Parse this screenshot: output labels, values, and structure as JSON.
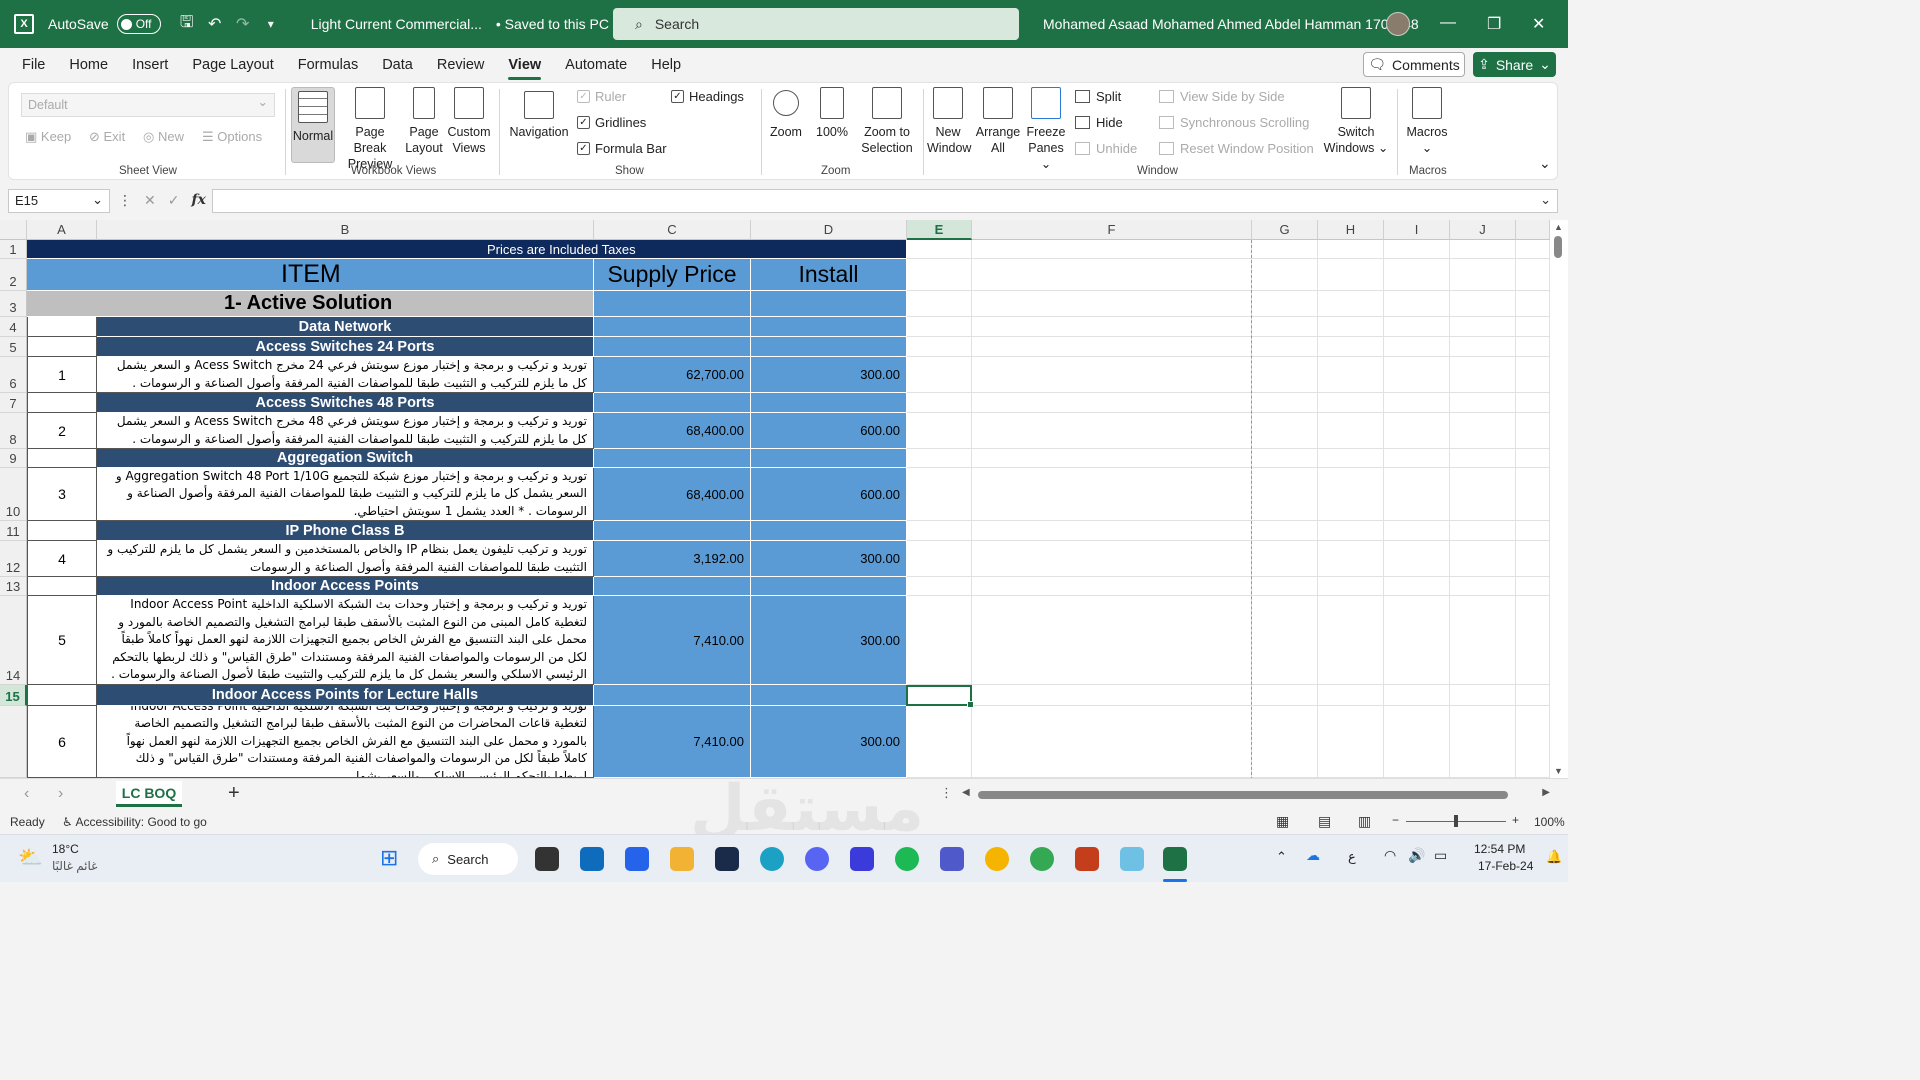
{
  "titlebar": {
    "autosave_label": "AutoSave",
    "autosave_state": "Off",
    "doc_title": "Light Current Commercial...",
    "saved_status": "• Saved to this PC ⌄",
    "search_placeholder": "Search",
    "user_name": "Mohamed Asaad Mohamed Ahmed Abdel Hamman 1701148"
  },
  "menu": {
    "items": [
      "File",
      "Home",
      "Insert",
      "Page Layout",
      "Formulas",
      "Data",
      "Review",
      "View",
      "Automate",
      "Help"
    ],
    "active": "View",
    "comments": "Comments",
    "share": "Share"
  },
  "ribbon": {
    "sheet_view": {
      "dropdown": "Default",
      "keep": "Keep",
      "exit": "Exit",
      "new": "New",
      "options": "Options",
      "label": "Sheet View"
    },
    "workbook_views": {
      "normal": "Normal",
      "page_break": "Page Break",
      "page_break2": "Preview",
      "page_layout": "Page",
      "page_layout2": "Layout",
      "custom": "Custom",
      "custom2": "Views",
      "label": "Workbook Views"
    },
    "show": {
      "navigation": "Navigation",
      "ruler": "Ruler",
      "gridlines": "Gridlines",
      "formula_bar": "Formula Bar",
      "headings": "Headings",
      "label": "Show"
    },
    "zoom": {
      "zoom": "Zoom",
      "hundred": "100%",
      "zoom_sel": "Zoom to",
      "zoom_sel2": "Selection",
      "label": "Zoom"
    },
    "window": {
      "new_window": "New",
      "new_window2": "Window",
      "arrange": "Arrange",
      "arrange2": "All",
      "freeze": "Freeze",
      "freeze2": "Panes ⌄",
      "split": "Split",
      "hide": "Hide",
      "unhide": "Unhide",
      "side": "View Side by Side",
      "sync": "Synchronous Scrolling",
      "reset": "Reset Window Position",
      "switch": "Switch",
      "switch2": "Windows ⌄",
      "label": "Window"
    },
    "macros": {
      "macros": "Macros",
      "label": "Macros"
    }
  },
  "formula_bar": {
    "name_box": "E15",
    "fx": "fx",
    "content": ""
  },
  "columns": [
    "A",
    "B",
    "C",
    "D",
    "E",
    "F",
    "G",
    "H",
    "I",
    "J"
  ],
  "rows": [
    "1",
    "2",
    "3",
    "4",
    "5",
    "6",
    "7",
    "8",
    "9",
    "10",
    "11",
    "12",
    "13",
    "14",
    "15"
  ],
  "sheet": {
    "r1_title": "Prices are Included Taxes",
    "header_item": "ITEM",
    "header_supply": "Supply Price",
    "header_install": "Install",
    "section": "1- Active Solution",
    "subsection": "Data Network",
    "groups": [
      {
        "title": "Access Switches 24 Ports",
        "no": "1",
        "desc": "توريد و تركيب و برمجة و إختبار موزع سويتش فرعي 24 مخرج Acess Switch و السعر يشمل كل ما يلزم للتركيب و التثبيت طبقا للمواصفات الفنية المرفقة وأصول الصناعة و الرسومات .",
        "supply": "62,700.00",
        "install": "300.00"
      },
      {
        "title": "Access Switches 48 Ports",
        "no": "2",
        "desc": "توريد و تركيب و برمجة و إختبار موزع سويتش فرعي 48 مخرج Acess Switch و السعر يشمل كل ما يلزم للتركيب و التثبيت طبقا للمواصفات الفنية المرفقة وأصول الصناعة و الرسومات .",
        "supply": "68,400.00",
        "install": "600.00"
      },
      {
        "title": "Aggregation Switch",
        "no": "3",
        "desc": "توريد و تركيب و برمجة و إختبار موزع شبكة للتجميع Aggregation Switch 48 Port 1/10G و السعر يشمل كل ما يلزم للتركيب و التثبيت طبقا للمواصفات الفنية المرفقة وأصول الصناعة و الرسومات . * العدد يشمل 1 سويتش احتياطي.",
        "supply": "68,400.00",
        "install": "600.00"
      },
      {
        "title": "IP Phone Class B",
        "no": "4",
        "desc": "توريد و تركيب تليفون يعمل بنظام IP والخاص بالمستخدمين و السعر يشمل كل ما يلزم للتركيب و التثبيت طبقا للمواصفات الفنية المرفقة وأصول الصناعة و الرسومات",
        "supply": "3,192.00",
        "install": "300.00"
      },
      {
        "title": "Indoor Access Points",
        "no": "5",
        "desc": "توريد و تركيب و برمجة و إختبار وحدات بث الشبكة الاسلكية الداخلية Indoor Access Point لتغطية كامل المبنى من النوع المثبت بالأسقف طبقا لبرامج التشغيل والتصميم الخاصة بالمورد و محمل على البند التنسيق مع الفرش الخاص بجميع التجهيزات اللازمة لنهو العمل نهواً كاملاً طبقاً لكل من الرسومات والمواصفات الفنية المرفقة ومستندات \"طرق القياس\" و ذلك لربطها بالتحكم الرئيسي الاسلكي والسعر يشمل كل ما يلزم للتركيب والتثبيت طبقا لأصول الصناعة والرسومات .",
        "supply": "7,410.00",
        "install": "300.00"
      },
      {
        "title": "Indoor Access Points for Lecture Halls",
        "no": "6",
        "desc": "توريد و تركيب و برمجة و إختبار وحدات بث الشبكة الاسلكية الداخلية Indoor Access Point لتغطية قاعات المحاضرات من النوع المثبت بالأسقف طبقا لبرامج التشغيل والتصميم الخاصة بالمورد و محمل على البند التنسيق مع الفرش الخاص بجميع التجهيزات اللازمة لنهو العمل نهواً كاملاً طبقاً لكل من الرسومات والمواصفات الفنية المرفقة ومستندات \"طرق القياس\" و ذلك لربطها بالتحكم الرئيسي الاسلكي والسعر يشمل",
        "supply": "7,410.00",
        "install": "300.00"
      }
    ]
  },
  "tabs": {
    "sheet": "LC BOQ",
    "add": "+"
  },
  "status": {
    "ready": "Ready",
    "accessibility": "Accessibility: Good to go",
    "zoom": "100%"
  },
  "taskbar": {
    "temp": "18°C",
    "weather": "غائم غالبًا",
    "search": "Search",
    "time": "12:54 PM",
    "date": "17-Feb-24",
    "lang": "ع"
  },
  "colors": {
    "excel_green": "#1e7145",
    "navy": "#0e2a5c",
    "blue": "#5b9bd5",
    "section_blue": "#2e4d73",
    "grey": "#bfbfbf"
  }
}
